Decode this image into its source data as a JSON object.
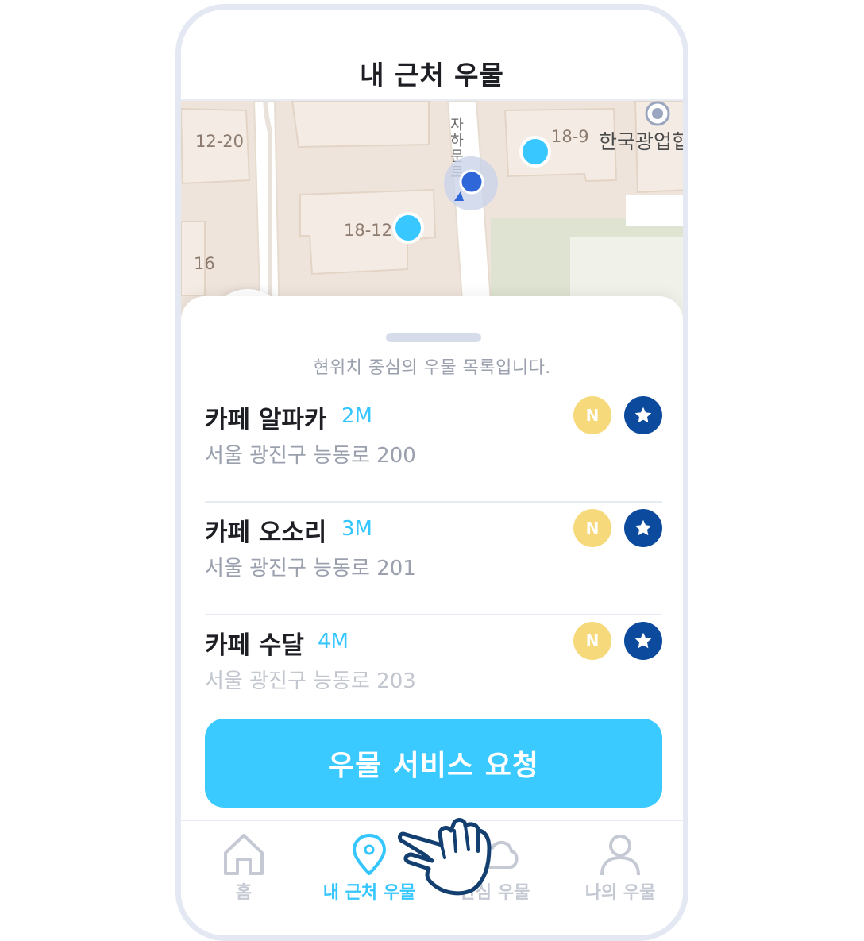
{
  "header": {
    "title": "내 근처 우물"
  },
  "map": {
    "labels": {
      "lot_12_20": "12-20",
      "lot_18_9": "18-9",
      "lot_18_12": "18-12",
      "lot_16": "16",
      "street": "자하문로",
      "place": "한국광업협"
    }
  },
  "sheet": {
    "caption": "현위치 중심의 우물 목록입니다.",
    "items": [
      {
        "name": "카페 알파카",
        "distance": "2M",
        "address": "서울 광진구 능동로 200",
        "badge": "N"
      },
      {
        "name": "카페 오소리",
        "distance": "3M",
        "address": "서울 광진구 능동로 201",
        "badge": "N"
      },
      {
        "name": "카페 수달",
        "distance": "4M",
        "address": "서울 광진구 능동로 203",
        "badge": "N"
      }
    ],
    "cta_label": "우물 서비스 요청"
  },
  "tabbar": {
    "tabs": [
      {
        "label": "홈",
        "icon": "home-icon"
      },
      {
        "label": "내 근처 우물",
        "icon": "location-pin-icon",
        "active": true
      },
      {
        "label": "관심 우물",
        "icon": "cloud-icon"
      },
      {
        "label": "나의 우물",
        "icon": "user-icon"
      }
    ]
  },
  "colors": {
    "accent": "#36c6ff",
    "button": "#3bcaff",
    "badge_n": "#f6d97a",
    "badge_star": "#0b4a9c",
    "map_building": "#f4ece4",
    "map_ground": "#efe4db"
  }
}
